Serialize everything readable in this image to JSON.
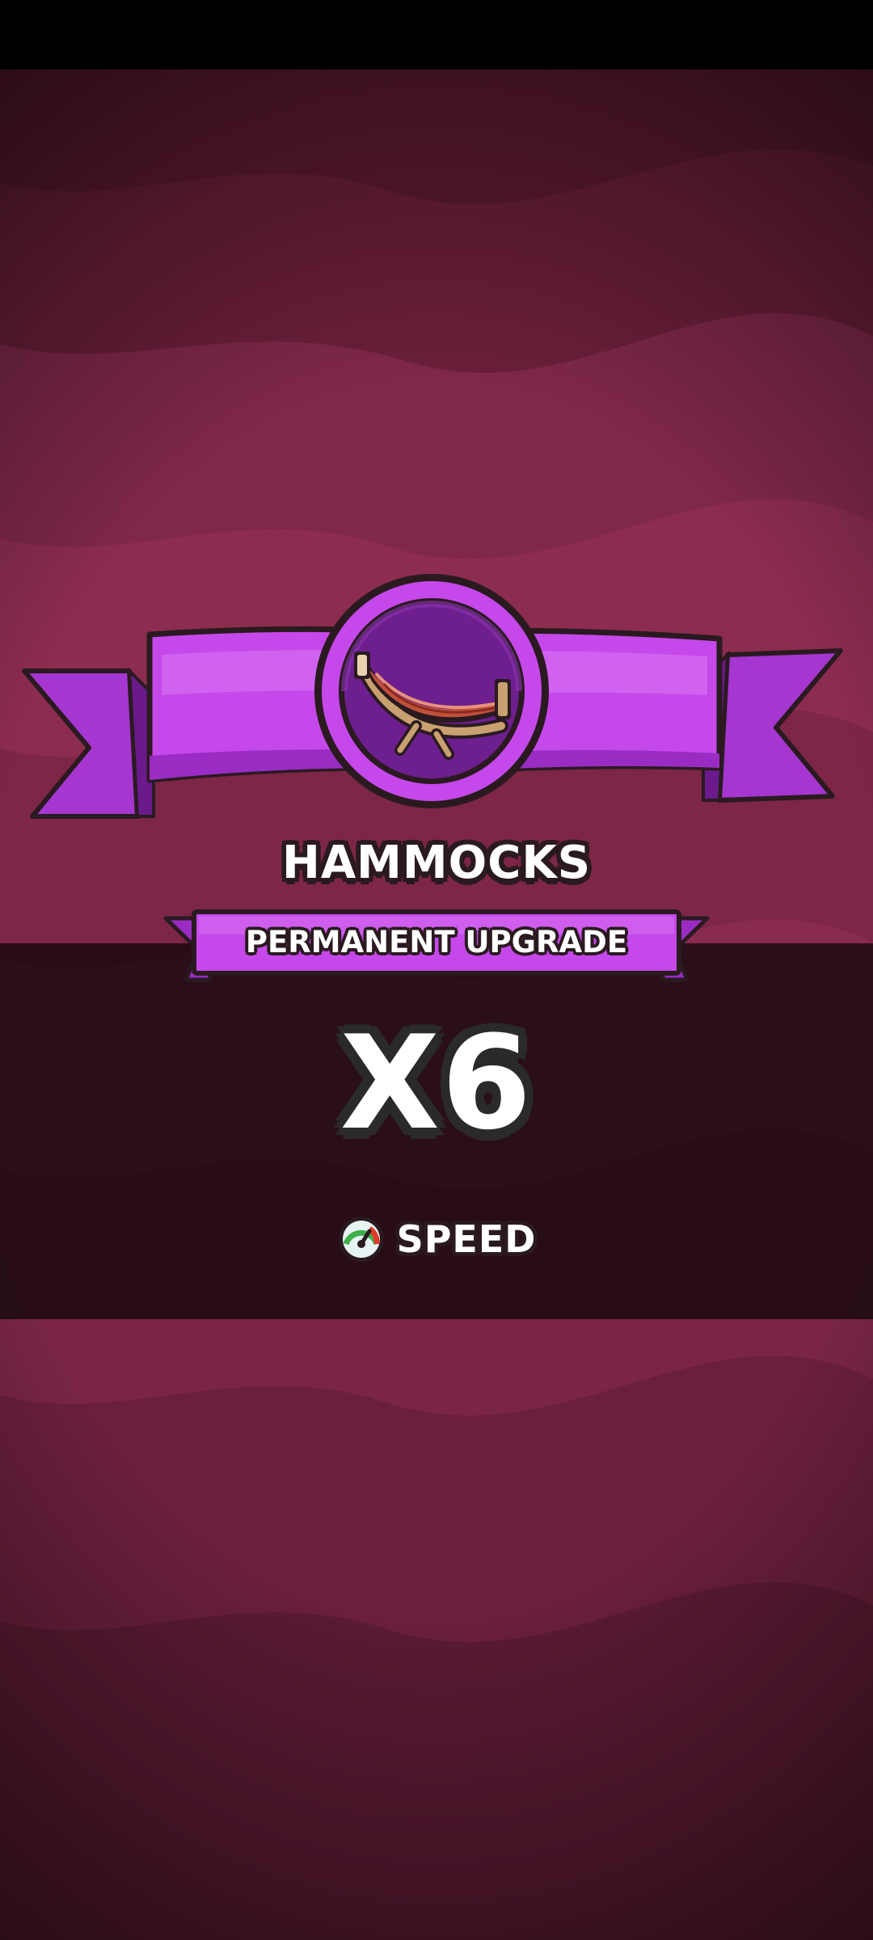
{
  "reward": {
    "item_name": "HAMMOCKS",
    "upgrade_type": "PERMANENT UPGRADE",
    "multiplier": "X6",
    "stat": {
      "label": "SPEED",
      "icon": "speedometer-icon"
    },
    "item_icon": "hammock-icon"
  },
  "colors": {
    "background": "#8a2a48",
    "background_dark": "#5a1a30",
    "banner_purple": "#c042e8",
    "banner_dark": "#7a1ea0",
    "outline": "#2a1a20"
  }
}
